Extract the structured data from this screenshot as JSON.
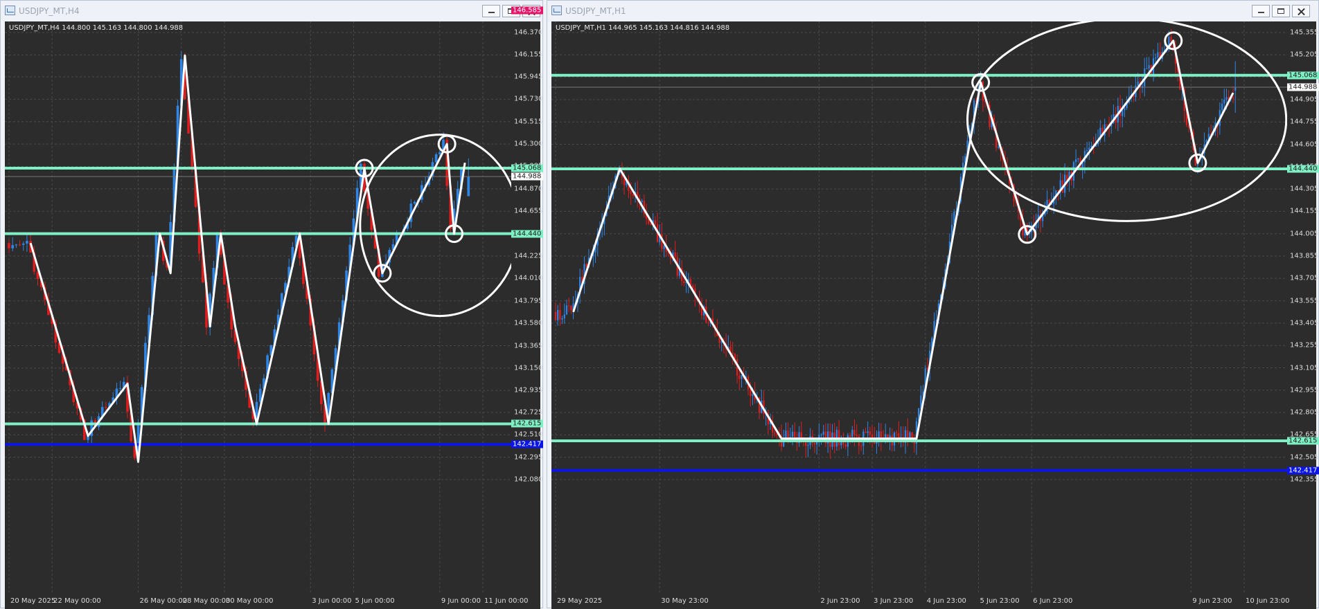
{
  "colors": {
    "bull": "#2f86e6",
    "bear": "#e11d1d",
    "level": "#7ff0c6",
    "blue_level": "#0b16e6",
    "top_level": "#e3166a",
    "background": "#2c2c2c"
  },
  "icons": [
    "app-icon",
    "minimize-icon",
    "maximize-icon",
    "close-icon"
  ],
  "windows": [
    {
      "title": "USDJPY_MT,H4",
      "info": "USDJPY_MT,H4  144.800 145.163 144.800 144.988",
      "price_ticks": [
        "146.370",
        "146.155",
        "145.945",
        "145.730",
        "145.515",
        "145.300",
        "145.085",
        "144.870",
        "144.655",
        "144.440",
        "144.225",
        "144.010",
        "143.795",
        "143.580",
        "143.365",
        "143.150",
        "142.935",
        "142.725",
        "142.510",
        "142.295",
        "142.080"
      ],
      "time_labels": [
        "20 May 2025",
        "22 May 00:00",
        "26 May 00:00",
        "28 May 00:00",
        "30 May 00:00",
        "3 Jun 00:00",
        "5 Jun 00:00",
        "9 Jun 00:00",
        "11 Jun 00:00"
      ],
      "tags": [
        {
          "text": "146.585",
          "bg": "#e3166a",
          "fg": "#ffffff",
          "price": 146.585
        },
        {
          "text": "145.068",
          "bg": "#7ff0c6",
          "fg": "#1a1a1a",
          "price": 145.068
        },
        {
          "text": "144.988",
          "bg": "#ffffff",
          "fg": "#1a1a1a",
          "price": 144.988
        },
        {
          "text": "144.440",
          "bg": "#7ff0c6",
          "fg": "#1a1a1a",
          "price": 144.44
        },
        {
          "text": "142.615",
          "bg": "#7ff0c6",
          "fg": "#1a1a1a",
          "price": 142.615
        },
        {
          "text": "142.417",
          "bg": "#0b16e6",
          "fg": "#ffffff",
          "price": 142.417
        }
      ]
    },
    {
      "title": "USDJPY_MT,H1",
      "info": "USDJPY_MT,H1  144.965 145.163 144.816 144.988",
      "price_ticks": [
        "145.355",
        "145.205",
        "145.055",
        "144.905",
        "144.755",
        "144.605",
        "144.455",
        "144.305",
        "144.155",
        "144.005",
        "143.855",
        "143.705",
        "143.555",
        "143.405",
        "143.255",
        "143.105",
        "142.955",
        "142.805",
        "142.655",
        "142.505",
        "142.355"
      ],
      "time_labels": [
        "29 May 2025",
        "30 May 23:00",
        "2 Jun 23:00",
        "3 Jun 23:00",
        "4 Jun 23:00",
        "5 Jun 23:00",
        "6 Jun 23:00",
        "9 Jun 23:00",
        "10 Jun 23:00"
      ],
      "tags": [
        {
          "text": "145.068",
          "bg": "#7ff0c6",
          "fg": "#1a1a1a",
          "price": 145.068
        },
        {
          "text": "144.988",
          "bg": "#ffffff",
          "fg": "#1a1a1a",
          "price": 144.988
        },
        {
          "text": "144.440",
          "bg": "#7ff0c6",
          "fg": "#1a1a1a",
          "price": 144.44
        },
        {
          "text": "142.615",
          "bg": "#7ff0c6",
          "fg": "#1a1a1a",
          "price": 142.615
        },
        {
          "text": "142.417",
          "bg": "#0b16e6",
          "fg": "#ffffff",
          "price": 142.417
        }
      ]
    }
  ],
  "chart_data": [
    {
      "type": "candlestick",
      "symbol": "USDJPY_MT",
      "timeframe": "H4",
      "ylim": [
        142.0,
        146.6
      ],
      "grid": true,
      "x_start": "20 May 2025",
      "x_end": "11 Jun 00:00",
      "levels": [
        146.585,
        145.068,
        144.44,
        142.615,
        142.417
      ],
      "current_price": 144.988,
      "last_bar": {
        "open": 144.8,
        "high": 145.163,
        "low": 144.8,
        "close": 144.988
      },
      "annotation_path": [
        {
          "date": "21 May 00:00",
          "price": 144.35
        },
        {
          "date": "23 May 16:00",
          "price": 142.5
        },
        {
          "date": "25 May 12:00",
          "price": 143.0
        },
        {
          "date": "26 May 00:00",
          "price": 142.25
        },
        {
          "date": "27 May 00:00",
          "price": 144.44
        },
        {
          "date": "27 May 12:00",
          "price": 144.06
        },
        {
          "date": "28 May 04:00",
          "price": 146.15
        },
        {
          "date": "29 May 08:00",
          "price": 143.55
        },
        {
          "date": "29 May 20:00",
          "price": 144.44
        },
        {
          "date": "30 May 12:00",
          "price": 143.55
        },
        {
          "date": "31 May 12:00",
          "price": 142.615
        },
        {
          "date": "2 Jun 12:00",
          "price": 144.44
        },
        {
          "date": "3 Jun 20:00",
          "price": 142.615
        },
        {
          "date": "5 Jun 12:00",
          "price": 145.068
        },
        {
          "date": "6 Jun 08:00",
          "price": 144.06
        },
        {
          "date": "9 Jun 08:00",
          "price": 145.3
        },
        {
          "date": "9 Jun 16:00",
          "price": 144.44
        },
        {
          "date": "10 Jun 04:00",
          "price": 145.12
        }
      ],
      "annotation_ellipse": {
        "center_date": "9 Jun 00:00",
        "center_price": 144.52,
        "date_span": "± 3.7 days",
        "price_span": "± 0.87"
      },
      "annotation_circles": [
        {
          "date": "5 Jun 12:00",
          "price": 145.068
        },
        {
          "date": "9 Jun 08:00",
          "price": 145.3
        },
        {
          "date": "9 Jun 16:00",
          "price": 144.44
        },
        {
          "date": "6 Jun 08:00",
          "price": 144.06
        }
      ]
    },
    {
      "type": "candlestick",
      "symbol": "USDJPY_MT",
      "timeframe": "H1",
      "ylim": [
        142.3,
        145.45
      ],
      "grid": true,
      "x_start": "29 May 2025",
      "x_end": "10 Jun 23:00",
      "levels": [
        145.068,
        144.44,
        142.615,
        142.417
      ],
      "current_price": 144.988,
      "last_bar": {
        "open": 144.965,
        "high": 145.163,
        "low": 144.816,
        "close": 144.988
      },
      "annotation_path": [
        {
          "date": "29 May 08:00",
          "price": 143.48
        },
        {
          "date": "30 May 05:00",
          "price": 144.44
        },
        {
          "date": "2 Jun 06:00",
          "price": 142.63
        },
        {
          "date": "4 Jun 19:00",
          "price": 142.63
        },
        {
          "date": "6 Jun 00:00",
          "price": 145.02
        },
        {
          "date": "6 Jun 21:00",
          "price": 144.0
        },
        {
          "date": "9 Jun 15:00",
          "price": 145.3
        },
        {
          "date": "10 Jun 02:00",
          "price": 144.48
        },
        {
          "date": "10 Jun 18:00",
          "price": 144.95
        }
      ],
      "annotation_ellipse": {
        "center_date": "8 Jun 18:00",
        "center_price": 144.77,
        "date_span": "± 3.0 days",
        "price_span": "± 0.68"
      },
      "annotation_circles": [
        {
          "date": "6 Jun 00:00",
          "price": 145.02
        },
        {
          "date": "9 Jun 15:00",
          "price": 145.3
        },
        {
          "date": "10 Jun 02:00",
          "price": 144.48
        },
        {
          "date": "6 Jun 21:00",
          "price": 144.0
        }
      ]
    }
  ]
}
